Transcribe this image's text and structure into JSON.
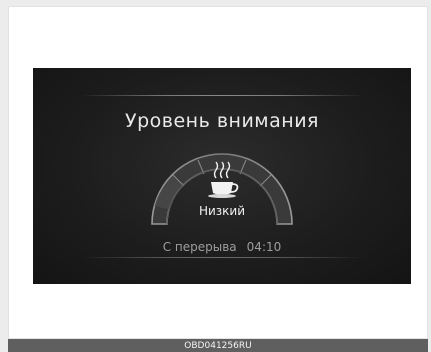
{
  "display": {
    "title": "Уровень внимания",
    "level_label": "Низкий",
    "break_label": "С перерыва",
    "break_time": "04:10",
    "icon": "coffee-cup-icon",
    "level_fraction": 0.25
  },
  "caption": "OBD041256RU",
  "colors": {
    "screen_bg": "#1d1d1d",
    "text_primary": "#e9e9e9",
    "text_secondary": "#9d9d9d",
    "caption_bar": "#5f5f5f"
  }
}
